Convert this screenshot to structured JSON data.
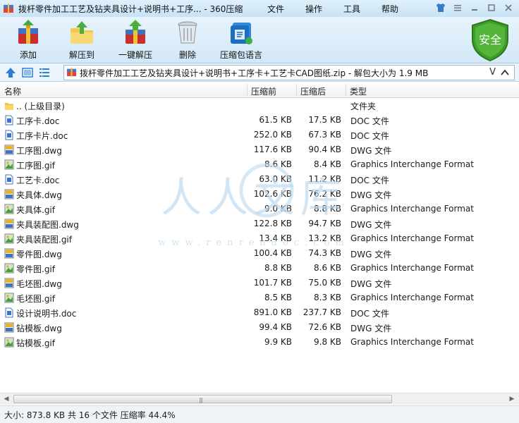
{
  "window": {
    "title": "拨杆零件加工工艺及钻夹具设计+说明书+工序... - 360压缩",
    "menu": [
      "文件",
      "操作",
      "工具",
      "帮助"
    ],
    "controls": [
      "shirt-icon",
      "menu-icon",
      "minimize-icon",
      "maximize-icon",
      "close-icon"
    ]
  },
  "toolbar": {
    "add": "添加",
    "extract_to": "解压到",
    "one_click_extract": "一键解压",
    "delete": "删除",
    "compressed_language": "压缩包语言",
    "badge": "安全"
  },
  "address": {
    "path": "拨杆零件加工工艺及钻夹具设计+说明书+工序卡+工艺卡CAD图纸.zip - 解包大小为 1.9 MB",
    "dropdown_glyph": "V"
  },
  "columns": {
    "name": "名称",
    "original": "压缩前",
    "compressed": "压缩后",
    "type": "类型"
  },
  "files": [
    {
      "name": ".. (上级目录)",
      "original": "",
      "compressed": "",
      "type": "文件夹",
      "icon": "folder-icon"
    },
    {
      "name": "工序卡.doc",
      "original": "61.5 KB",
      "compressed": "17.5 KB",
      "type": "DOC 文件",
      "icon": "doc-file-icon"
    },
    {
      "name": "工序卡片.doc",
      "original": "252.0 KB",
      "compressed": "67.3 KB",
      "type": "DOC 文件",
      "icon": "doc-file-icon"
    },
    {
      "name": "工序图.dwg",
      "original": "117.6 KB",
      "compressed": "90.4 KB",
      "type": "DWG 文件",
      "icon": "dwg-file-icon"
    },
    {
      "name": "工序图.gif",
      "original": "8.6 KB",
      "compressed": "8.4 KB",
      "type": "Graphics Interchange Format",
      "icon": "gif-file-icon"
    },
    {
      "name": "工艺卡.doc",
      "original": "63.0 KB",
      "compressed": "11.2 KB",
      "type": "DOC 文件",
      "icon": "doc-file-icon"
    },
    {
      "name": "夹具体.dwg",
      "original": "102.6 KB",
      "compressed": "76.2 KB",
      "type": "DWG 文件",
      "icon": "dwg-file-icon"
    },
    {
      "name": "夹具体.gif",
      "original": "9.0 KB",
      "compressed": "8.8 KB",
      "type": "Graphics Interchange Format",
      "icon": "gif-file-icon"
    },
    {
      "name": "夹具装配图.dwg",
      "original": "122.8 KB",
      "compressed": "94.7 KB",
      "type": "DWG 文件",
      "icon": "dwg-file-icon"
    },
    {
      "name": "夹具装配图.gif",
      "original": "13.4 KB",
      "compressed": "13.2 KB",
      "type": "Graphics Interchange Format",
      "icon": "gif-file-icon"
    },
    {
      "name": "零件图.dwg",
      "original": "100.4 KB",
      "compressed": "74.3 KB",
      "type": "DWG 文件",
      "icon": "dwg-file-icon"
    },
    {
      "name": "零件图.gif",
      "original": "8.8 KB",
      "compressed": "8.6 KB",
      "type": "Graphics Interchange Format",
      "icon": "gif-file-icon"
    },
    {
      "name": "毛坯图.dwg",
      "original": "101.7 KB",
      "compressed": "75.0 KB",
      "type": "DWG 文件",
      "icon": "dwg-file-icon"
    },
    {
      "name": "毛坯图.gif",
      "original": "8.5 KB",
      "compressed": "8.3 KB",
      "type": "Graphics Interchange Format",
      "icon": "gif-file-icon"
    },
    {
      "name": "设计说明书.doc",
      "original": "891.0 KB",
      "compressed": "237.7 KB",
      "type": "DOC 文件",
      "icon": "doc-file-icon"
    },
    {
      "name": "钻模板.dwg",
      "original": "99.4 KB",
      "compressed": "72.6 KB",
      "type": "DWG 文件",
      "icon": "dwg-file-icon"
    },
    {
      "name": "钻模板.gif",
      "original": "9.9 KB",
      "compressed": "9.8 KB",
      "type": "Graphics Interchange Format",
      "icon": "gif-file-icon"
    }
  ],
  "watermark": {
    "logo_text": "人人文库",
    "url_text": "www.renrendoc.com"
  },
  "status": "大小: 873.8 KB 共 16 个文件 压缩率 44.4%",
  "colors": {
    "titlebar": "#c8e3f6",
    "toolbar": "#d3e8f7",
    "shield_green": "#3f9d2c",
    "watermark": "#bcd8ee"
  }
}
